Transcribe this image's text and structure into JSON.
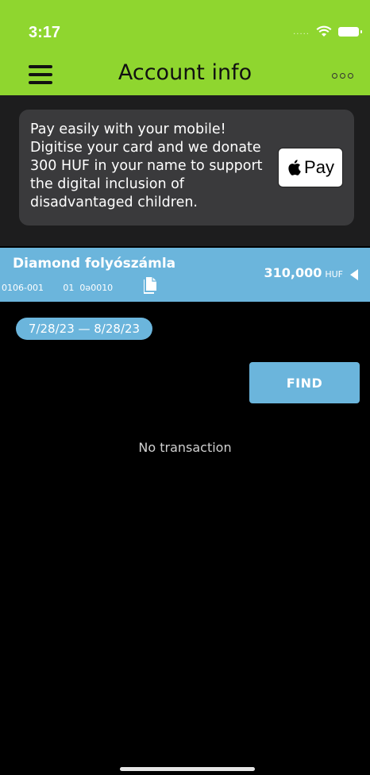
{
  "status_bar": {
    "time": "3:17",
    "signal": "....."
  },
  "nav": {
    "title": "Account info"
  },
  "banner": {
    "text": "Pay easily with your mobile! Digitise your card and we donate 300 HUF in your name to support the digital inclusion of disadvantaged children.",
    "pay_label": "Pay"
  },
  "account": {
    "name": "Diamond folyószámla",
    "number": "0106-001       01  0ǝ0010",
    "balance": "310,000",
    "currency": "HUF"
  },
  "filter": {
    "date_range": "7/28/23  —  8/28/23",
    "find_label": "FIND"
  },
  "transactions": {
    "empty_text": "No transaction"
  },
  "colors": {
    "header_green": "#8fd62f",
    "accent_blue": "#6bb5dc",
    "banner_bg": "#3a3a3c"
  },
  "icons": [
    "menu-icon",
    "more-icon",
    "apple-icon",
    "copy-icon",
    "collapse-arrow-icon",
    "wifi-icon",
    "battery-icon"
  ]
}
